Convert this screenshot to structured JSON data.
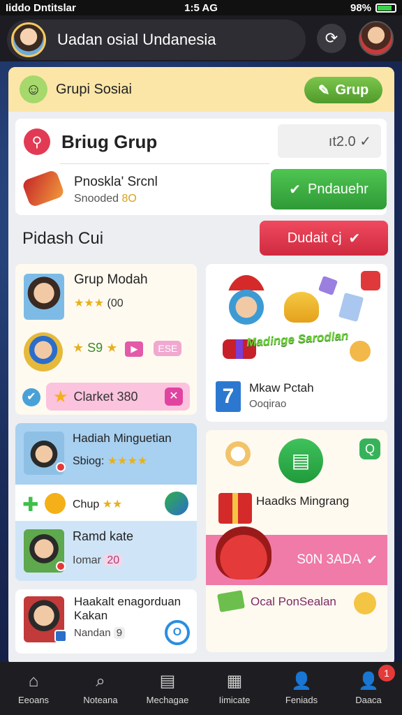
{
  "status_bar": {
    "carrier": "Iiddo Dntitslar",
    "time": "1:5 AG",
    "battery": "98%"
  },
  "top_bar": {
    "title": "Uadan osial Undanesia"
  },
  "header": {
    "label": "Grupi Sosiai",
    "button_label": "Grup"
  },
  "brug_card": {
    "title": "Briug Grup",
    "count": "ıt2.0 ✓",
    "item_title": "Pnoskla' Srcnl",
    "item_sub": "Snooded",
    "item_sub_value": "8O",
    "action_label": "Pndauehr"
  },
  "section": {
    "title": "Pidash Cui",
    "button_label": "Dudait cj"
  },
  "card1": {
    "title": "Grup Modah",
    "rating_text": "(00",
    "rating_stars": "★★★",
    "row2_stars": "★",
    "row2_value": "S9",
    "row2_tag": "ESE",
    "pill_label": "Clarket 380"
  },
  "card2": {
    "banner": "Madinge Sarodlan",
    "meta_title": "Mkaw Pctah",
    "meta_sub": "Ooqirao"
  },
  "card3": {
    "title": "Hadiah Minguetian",
    "sub_label": "Sbiog:",
    "sub_stars": "★★★★",
    "mid_label": "Chup",
    "mid_stars": "★★",
    "b_title": "Ramd kate",
    "b_label": "Iomar",
    "b_value": "20"
  },
  "card4": {
    "heading": "Haadks Mingrang",
    "band_text": "S0N 3ADA",
    "promo_text": "Ocal PonSealan"
  },
  "card5": {
    "title": "Haakalt enagorduan Kakan",
    "label": "Nandan",
    "value": "9"
  },
  "bottom_nav": {
    "items": [
      {
        "label": "Eeoans",
        "icon": "home-icon"
      },
      {
        "label": "Noteana",
        "icon": "search-icon"
      },
      {
        "label": "Mechagae",
        "icon": "media-icon"
      },
      {
        "label": "Iimicate",
        "icon": "grid-icon"
      },
      {
        "label": "Feniads",
        "icon": "person-icon"
      },
      {
        "label": "Daaca",
        "icon": "profile-icon"
      }
    ],
    "badge": "1"
  },
  "colors": {
    "header_band": "#fbe6a8",
    "green_button": "#4fc552",
    "red_button": "#ef4a5e",
    "pink_band": "#f07aa8",
    "star": "#e6b11f"
  }
}
